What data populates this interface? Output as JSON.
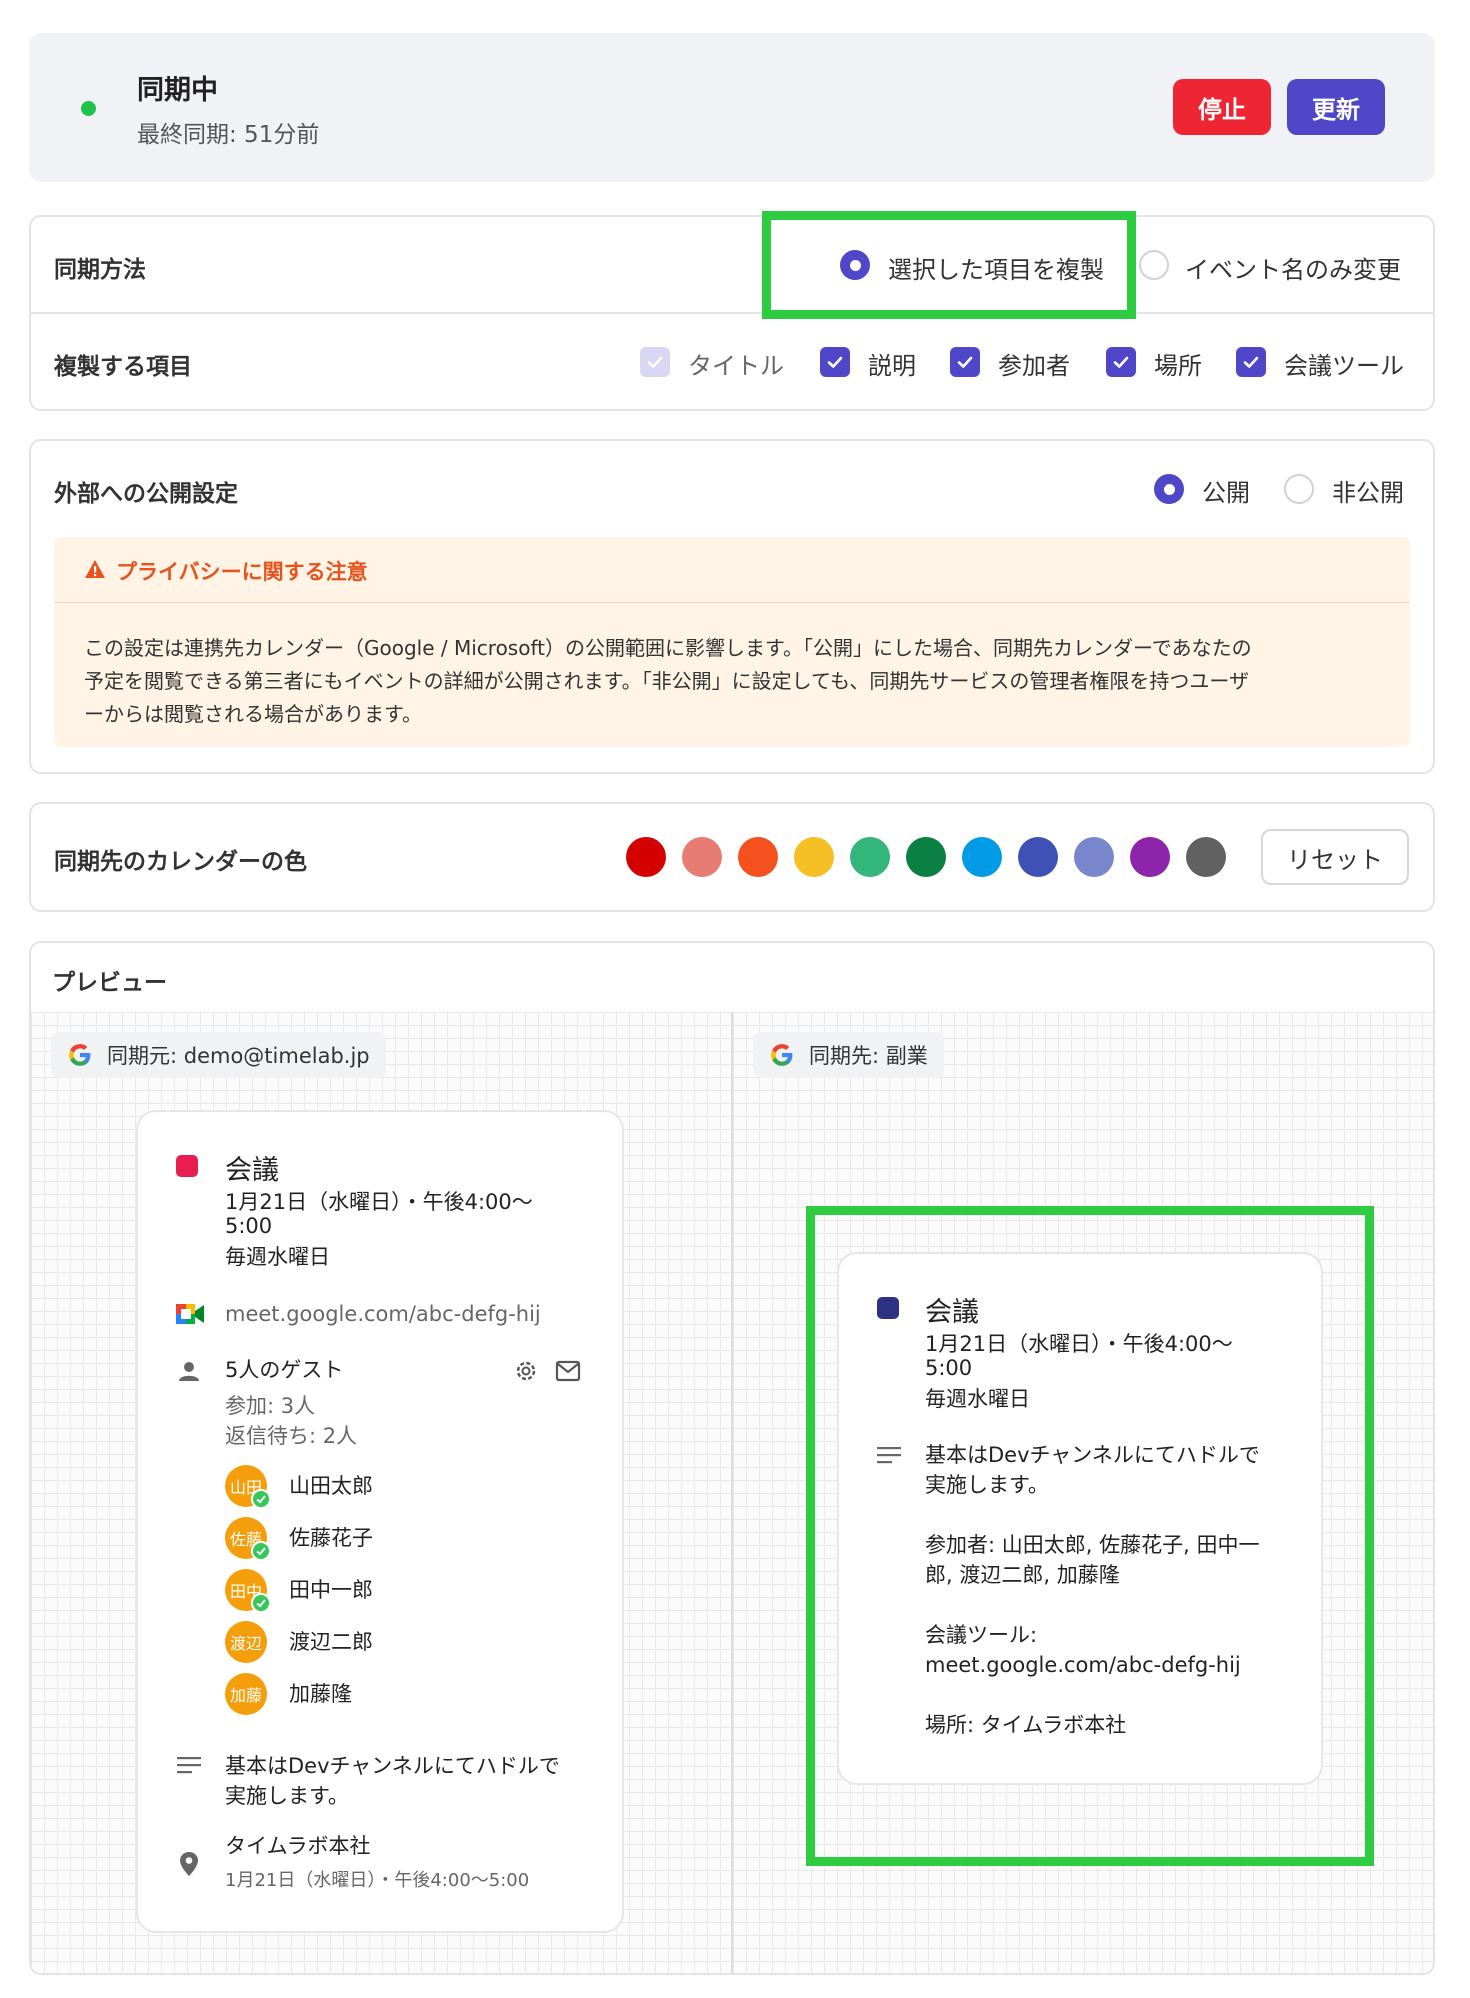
{
  "status": {
    "title": "同期中",
    "last_sync": "最終同期: 51分前",
    "stop_label": "停止",
    "update_label": "更新"
  },
  "sync_method": {
    "label": "同期方法",
    "options": [
      {
        "label": "選択した項目を複製",
        "selected": true
      },
      {
        "label": "イベント名のみ変更",
        "selected": false
      }
    ]
  },
  "copy_items": {
    "label": "複製する項目",
    "items": [
      {
        "label": "タイトル",
        "checked": true,
        "disabled": true
      },
      {
        "label": "説明",
        "checked": true
      },
      {
        "label": "参加者",
        "checked": true
      },
      {
        "label": "場所",
        "checked": true
      },
      {
        "label": "会議ツール",
        "checked": true
      }
    ]
  },
  "visibility": {
    "label": "外部への公開設定",
    "options": [
      {
        "label": "公開",
        "selected": true
      },
      {
        "label": "非公開",
        "selected": false
      }
    ],
    "warning_title": "プライバシーに関する注意",
    "warning_lines": [
      "この設定は連携先カレンダー（Google / Microsoft）の公開範囲に影響します。「公開」にした場合、同期先カレンダーであなたの",
      "予定を閲覧できる第三者にもイベントの詳細が公開されます。「非公開」に設定しても、同期先サービスの管理者権限を持つユーザ",
      "ーからは閲覧される場合があります。"
    ]
  },
  "calendar_color": {
    "label": "同期先のカレンダーの色",
    "colors": [
      "#d50000",
      "#e67c73",
      "#f4511e",
      "#f6bf26",
      "#33b679",
      "#0b8043",
      "#039be5",
      "#3f51b5",
      "#7986cb",
      "#8e24aa",
      "#616161"
    ],
    "reset_label": "リセット"
  },
  "preview": {
    "label": "プレビュー",
    "source": {
      "label": "同期元: demo@timelab.jp",
      "event": {
        "color": "#e91e50",
        "title": "会議",
        "date_lines": [
          "1月21日（水曜日）・午後4:00〜",
          "5:00"
        ],
        "recurrence": "毎週水曜日",
        "meet_link": "meet.google.com/abc-defg-hij",
        "guests_title": "5人のゲスト",
        "guests_yes": "参加: 3人",
        "guests_pending": "返信待ち: 2人",
        "guests": [
          {
            "initials": "山田",
            "name": "山田太郎",
            "accepted": true
          },
          {
            "initials": "佐藤",
            "name": "佐藤花子",
            "accepted": true
          },
          {
            "initials": "田中",
            "name": "田中一郎",
            "accepted": true
          },
          {
            "initials": "渡辺",
            "name": "渡辺二郎",
            "accepted": false
          },
          {
            "initials": "加藤",
            "name": "加藤隆",
            "accepted": false
          }
        ],
        "description_lines": [
          "基本はDevチャンネルにてハドルで",
          "実施します。"
        ],
        "location": "タイムラボ本社",
        "location_time": "1月21日（水曜日）・午後4:00〜5:00"
      }
    },
    "destination": {
      "label": "同期先: 副業",
      "event": {
        "color": "#2d3285",
        "title": "会議",
        "date_lines": [
          "1月21日（水曜日）・午後4:00〜",
          "5:00"
        ],
        "recurrence": "毎週水曜日",
        "description_lines": [
          "基本はDevチャンネルにてハドルで",
          "実施します。"
        ],
        "attendees_lines": [
          "参加者: 山田太郎, 佐藤花子, 田中一",
          "郎, 渡辺二郎, 加藤隆"
        ],
        "meeting_lines": [
          "会議ツール:",
          "meet.google.com/abc-defg-hij"
        ],
        "place": "場所: タイムラボ本社"
      }
    }
  }
}
